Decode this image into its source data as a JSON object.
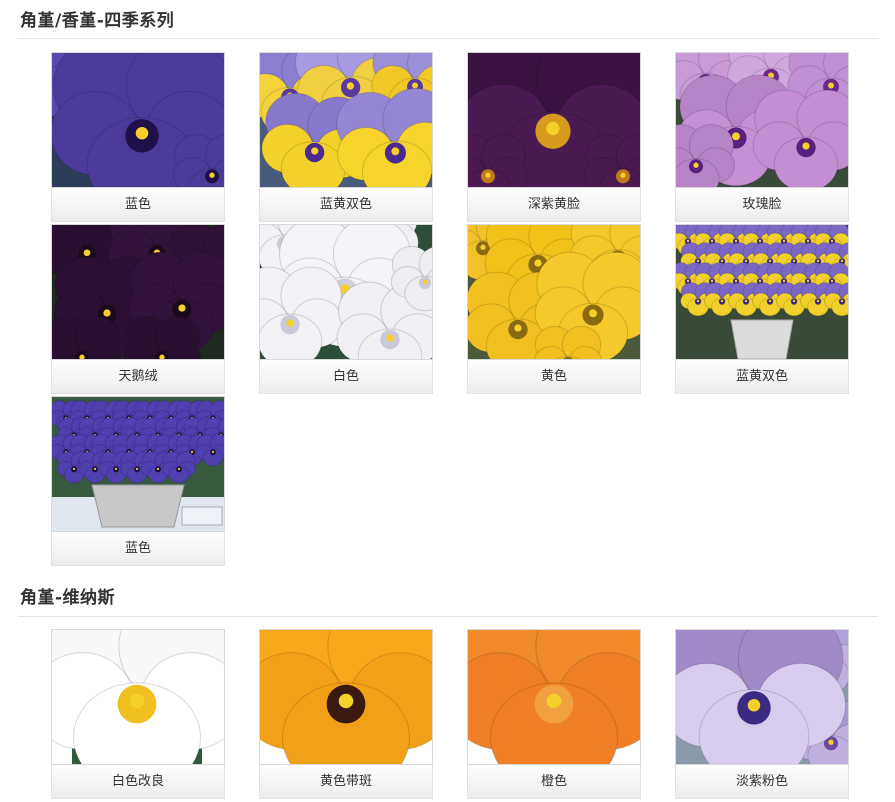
{
  "sections": [
    {
      "title": "角堇/香堇-四季系列",
      "items": [
        {
          "label": "蓝色",
          "img": "blue"
        },
        {
          "label": "蓝黄双色",
          "img": "blueyellow"
        },
        {
          "label": "深紫黄脸",
          "img": "darkpurple"
        },
        {
          "label": "玫瑰脸",
          "img": "rose"
        },
        {
          "label": "天鹅绒",
          "img": "velvet"
        },
        {
          "label": "白色",
          "img": "white"
        },
        {
          "label": "黄色",
          "img": "yellow"
        },
        {
          "label": "蓝黄双色",
          "img": "potbicolor"
        },
        {
          "label": "蓝色",
          "img": "potblue"
        }
      ]
    },
    {
      "title": "角堇-维纳斯",
      "items": [
        {
          "label": "白色改良",
          "img": "venuswhite"
        },
        {
          "label": "黄色带斑",
          "img": "venusyellow"
        },
        {
          "label": "橙色",
          "img": "venusorange"
        },
        {
          "label": "淡紫粉色",
          "img": "venuslavender"
        }
      ]
    }
  ],
  "colors": {
    "blue_petal": "#4b3a9a",
    "yellow_petal": "#f2c21b",
    "dark_purple": "#3a1240",
    "rose_petal": "#b884c8",
    "white_petal": "#f4f4f8",
    "orange_petal": "#f08a2a",
    "lavender_petal": "#a08ac8",
    "foliage": "#2e5a3a"
  }
}
